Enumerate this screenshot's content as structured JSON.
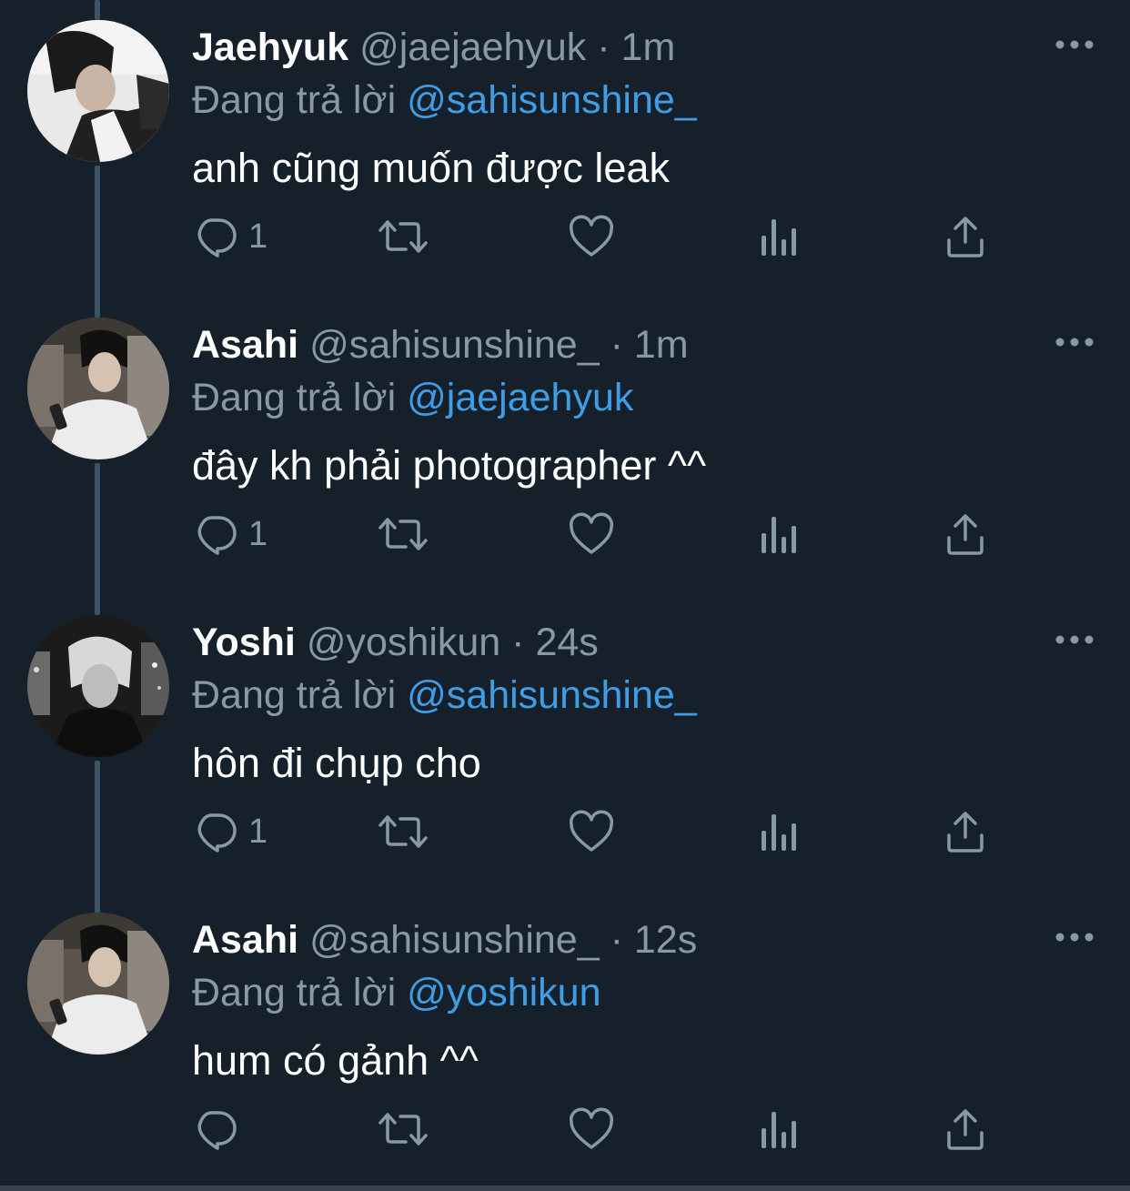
{
  "tweets": [
    {
      "name": "Jaehyuk",
      "handle": "@jaejaehyuk",
      "sep": " · ",
      "time": "1m",
      "replying_prefix": "Đang trả lời ",
      "replying_to": "@sahisunshine_",
      "text": "anh cũng muốn được leak",
      "reply_count": "1",
      "avatar_tone": "light"
    },
    {
      "name": "Asahi",
      "handle": "@sahisunshine_",
      "sep": " · ",
      "time": "1m",
      "replying_prefix": "Đang trả lời ",
      "replying_to": "@jaejaehyuk",
      "text": "đây kh phải photographer ^^",
      "reply_count": "1",
      "avatar_tone": "car"
    },
    {
      "name": "Yoshi",
      "handle": "@yoshikun",
      "sep": " · ",
      "time": "24s",
      "replying_prefix": "Đang trả lời ",
      "replying_to": "@sahisunshine_",
      "text": "hôn đi chụp cho",
      "reply_count": "1",
      "avatar_tone": "night"
    },
    {
      "name": "Asahi",
      "handle": "@sahisunshine_",
      "sep": " · ",
      "time": "12s",
      "replying_prefix": "Đang trả lời ",
      "replying_to": "@yoshikun",
      "text": "hum có gảnh ^^",
      "reply_count": "",
      "avatar_tone": "car"
    }
  ],
  "colors": {
    "background": "#15202b",
    "secondary_text": "#8899a6",
    "mention": "#3f9de6",
    "thread_line": "#3d5466"
  },
  "icons": [
    "reply-icon",
    "retweet-icon",
    "like-icon",
    "views-icon",
    "share-icon",
    "more-icon"
  ]
}
